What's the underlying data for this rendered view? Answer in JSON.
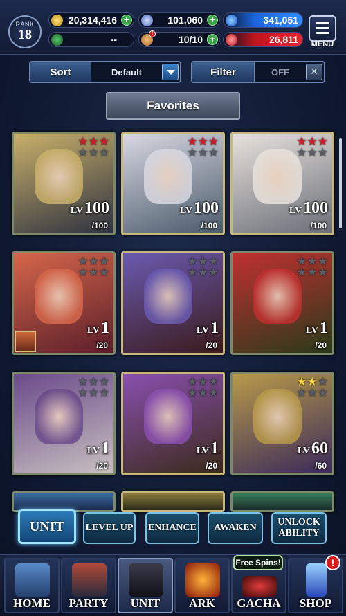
{
  "rank": {
    "label": "RANK",
    "value": "18"
  },
  "resources": {
    "gold": "20,314,416",
    "crystals": "101,060",
    "orbs": "341,051",
    "sword": "--",
    "energy": "10/10",
    "red": "26,811"
  },
  "menu_label": "MENU",
  "sort": {
    "label": "Sort",
    "value": "Default"
  },
  "filter": {
    "label": "Filter",
    "value": "OFF"
  },
  "favorites_label": "Favorites",
  "units": [
    {
      "lv_label": "LV",
      "level": "100",
      "max": "/100",
      "stars_red": 3,
      "stars_gray": 3,
      "colors": [
        "#c9b06a",
        "#2e3240"
      ]
    },
    {
      "lv_label": "LV",
      "level": "100",
      "max": "/100",
      "stars_red": 3,
      "stars_gray": 3,
      "colors": [
        "#d8d8e2",
        "#4a5a6a"
      ]
    },
    {
      "lv_label": "LV",
      "level": "100",
      "max": "/100",
      "stars_red": 3,
      "stars_gray": 3,
      "colors": [
        "#e8e2dc",
        "#6a6e78"
      ]
    },
    {
      "lv_label": "LV",
      "level": "1",
      "max": "/20",
      "stars_red": 0,
      "stars_gray": 6,
      "colors": [
        "#d5664a",
        "#5a1f2a"
      ]
    },
    {
      "lv_label": "LV",
      "level": "1",
      "max": "/20",
      "stars_red": 0,
      "stars_gray": 6,
      "colors": [
        "#6a5ab0",
        "#3a1a1a"
      ]
    },
    {
      "lv_label": "LV",
      "level": "1",
      "max": "/20",
      "stars_red": 0,
      "stars_gray": 6,
      "colors": [
        "#c03030",
        "#2a3a1a"
      ]
    },
    {
      "lv_label": "LV",
      "level": "1",
      "max": "/20",
      "stars_red": 0,
      "stars_gray": 6,
      "colors": [
        "#6a4a8a",
        "#c8c0c0"
      ]
    },
    {
      "lv_label": "LV",
      "level": "1",
      "max": "/20",
      "stars_red": 0,
      "stars_gray": 6,
      "colors": [
        "#8a50b0",
        "#3a2a1a"
      ]
    },
    {
      "lv_label": "LV",
      "level": "60",
      "max": "/60",
      "stars_gold": 2,
      "stars_gray": 4,
      "colors": [
        "#b89a4a",
        "#3a2a5a"
      ]
    }
  ],
  "actions": {
    "unit": "UNIT",
    "level_up": "LEVEL UP",
    "enhance": "ENHANCE",
    "awaken": "AWAKEN",
    "unlock_ability": "UNLOCK ABILITY"
  },
  "nav": {
    "home": "HOME",
    "party": "PARTY",
    "unit": "UNIT",
    "ark": "ARK",
    "gacha": "GACHA",
    "shop": "SHOP",
    "free_spins": "Free Spins!",
    "shop_badge": "!"
  },
  "colors": {
    "accent_blue": "#7ec2e8",
    "star_red": "#d8182a",
    "star_gold": "#ffd84a",
    "alert_red": "#d61b1b"
  }
}
